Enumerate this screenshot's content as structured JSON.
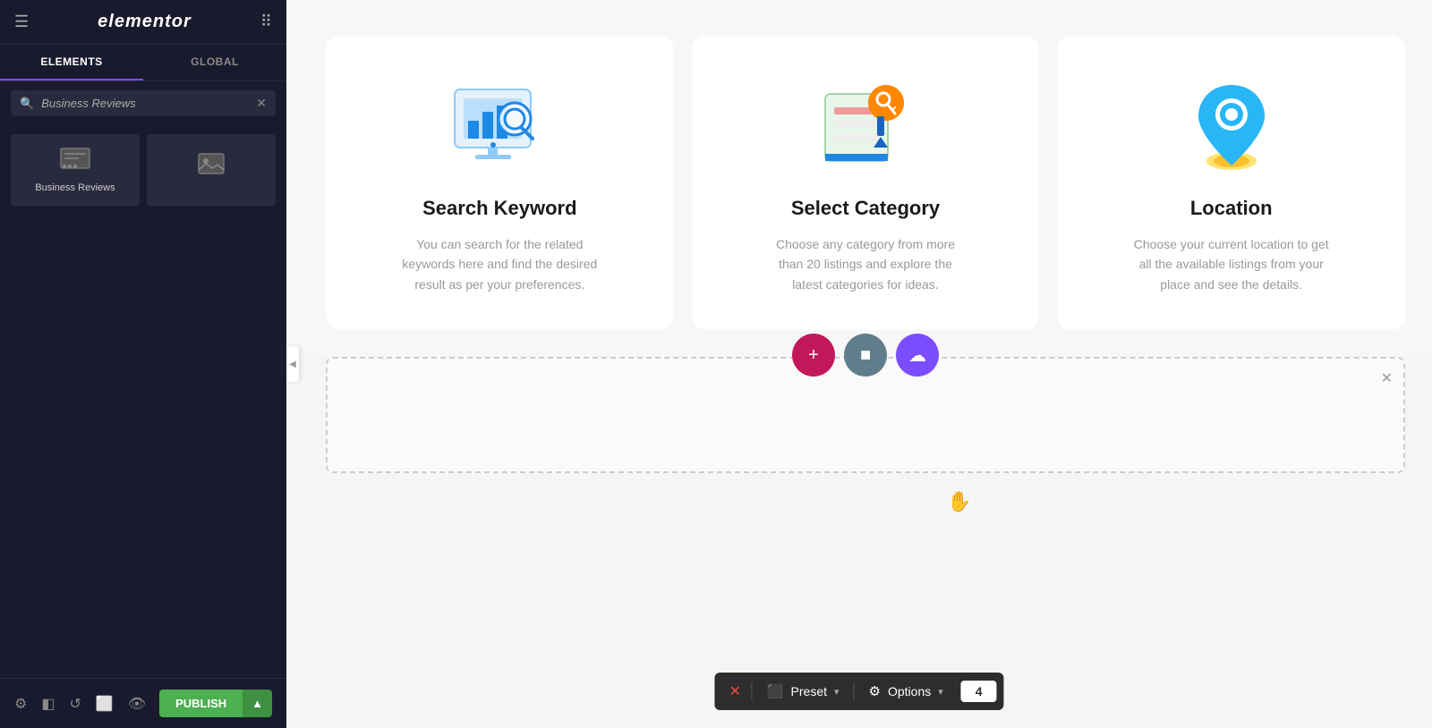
{
  "sidebar": {
    "logo": "elementor",
    "tabs": [
      {
        "id": "elements",
        "label": "ELEMENTS",
        "active": true
      },
      {
        "id": "global",
        "label": "GLOBAL",
        "active": false
      }
    ],
    "search": {
      "placeholder": "Business Reviews",
      "value": "Business Reviews"
    },
    "widgets": [
      {
        "id": "business-reviews",
        "label": "Business Reviews",
        "icon": "widget"
      },
      {
        "id": "image-widget",
        "label": "",
        "icon": "image"
      }
    ],
    "footer": {
      "publish_label": "PUBLISH",
      "arrow_label": "▲"
    }
  },
  "cards": [
    {
      "id": "search-keyword",
      "title": "Search Keyword",
      "description": "You can search for the related keywords here and find the desired result as per your preferences."
    },
    {
      "id": "select-category",
      "title": "Select Category",
      "description": "Choose any category from more than 20 listings and explore the latest categories for ideas."
    },
    {
      "id": "location",
      "title": "Location",
      "description": "Choose your current location to get all the available listings from your place and see the details."
    }
  ],
  "toolbar": {
    "close_icon": "✕",
    "preset_icon": "⬜",
    "preset_label": "Preset",
    "preset_chevron": "▾",
    "options_icon": "⚙",
    "options_label": "Options",
    "options_chevron": "▾",
    "count": "4"
  },
  "floating_buttons": {
    "add_icon": "+",
    "stop_icon": "■",
    "share_icon": "☁"
  },
  "drop_section": {
    "close_icon": "✕"
  }
}
